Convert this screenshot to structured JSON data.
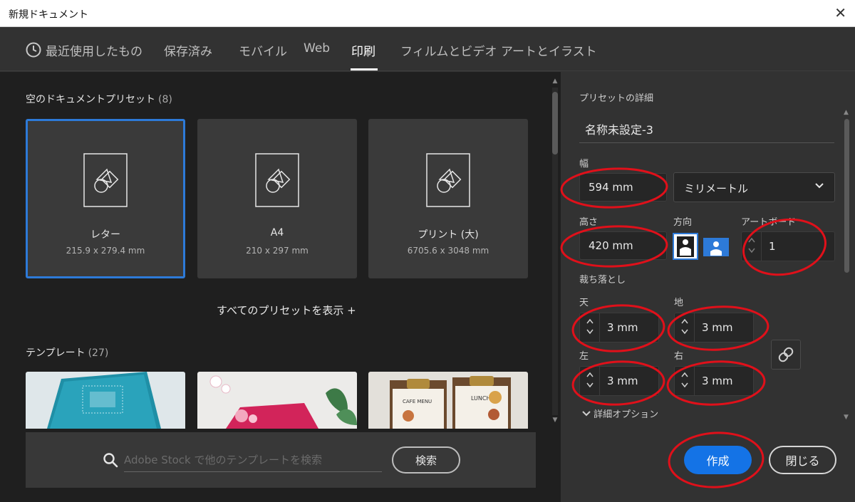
{
  "window": {
    "title": "新規ドキュメント"
  },
  "tabs": [
    {
      "label": "最近使用したもの",
      "active": false
    },
    {
      "label": "保存済み",
      "active": false
    },
    {
      "label": "モバイル",
      "active": false
    },
    {
      "label": "Web",
      "active": false
    },
    {
      "label": "印刷",
      "active": true
    },
    {
      "label": "フィルムとビデオ",
      "active": false
    },
    {
      "label": "アートとイラスト",
      "active": false
    }
  ],
  "presets_section": {
    "title": "空のドキュメントプリセット",
    "count": "(8)"
  },
  "presets": [
    {
      "name": "レター",
      "size": "215.9 x 279.4 mm",
      "selected": true
    },
    {
      "name": "A4",
      "size": "210 x 297 mm",
      "selected": false
    },
    {
      "name": "プリント (大)",
      "size": "6705.6 x 3048 mm",
      "selected": false
    }
  ],
  "see_all_label": "すべてのプリセットを表示 +",
  "templates_section": {
    "title": "テンプレート",
    "count": "(27)"
  },
  "search": {
    "placeholder": "Adobe Stock で他のテンプレートを検索",
    "button_label": "検索"
  },
  "details": {
    "title": "プリセットの詳細",
    "document_name": "名称未設定-3",
    "width_label": "幅",
    "width_value": "594 mm",
    "unit_value": "ミリメートル",
    "height_label": "高さ",
    "height_value": "420 mm",
    "orientation_label": "方向",
    "artboards_label": "アートボード",
    "artboards_value": "1",
    "bleed_label": "裁ち落とし",
    "bleed_top_label": "天",
    "bleed_top_value": "3 mm",
    "bleed_bottom_label": "地",
    "bleed_bottom_value": "3 mm",
    "bleed_left_label": "左",
    "bleed_left_value": "3 mm",
    "bleed_right_label": "右",
    "bleed_right_value": "3 mm",
    "advanced_label": "詳細オプション",
    "create_label": "作成",
    "close_label": "閉じる"
  },
  "colors": {
    "accent": "#1473e6",
    "selection": "#2d7ad8",
    "annotation": "#e0101a"
  }
}
